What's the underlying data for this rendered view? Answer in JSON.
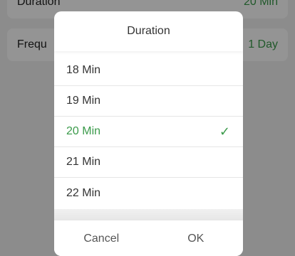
{
  "background": {
    "duration_label": "Duration",
    "duration_value": "20 Min",
    "frequency_label": "Frequ",
    "frequency_value": "1 Day"
  },
  "dialog": {
    "title": "Duration",
    "options": [
      {
        "label": "18 Min"
      },
      {
        "label": "19 Min"
      },
      {
        "label": "20 Min"
      },
      {
        "label": "21 Min"
      },
      {
        "label": "22 Min"
      }
    ],
    "selected_index": 2,
    "check_glyph": "✓",
    "cancel_label": "Cancel",
    "ok_label": "OK"
  },
  "colors": {
    "accent": "#3a9a4a",
    "text": "#333333"
  },
  "icons": {
    "checkmark": "check-icon"
  }
}
